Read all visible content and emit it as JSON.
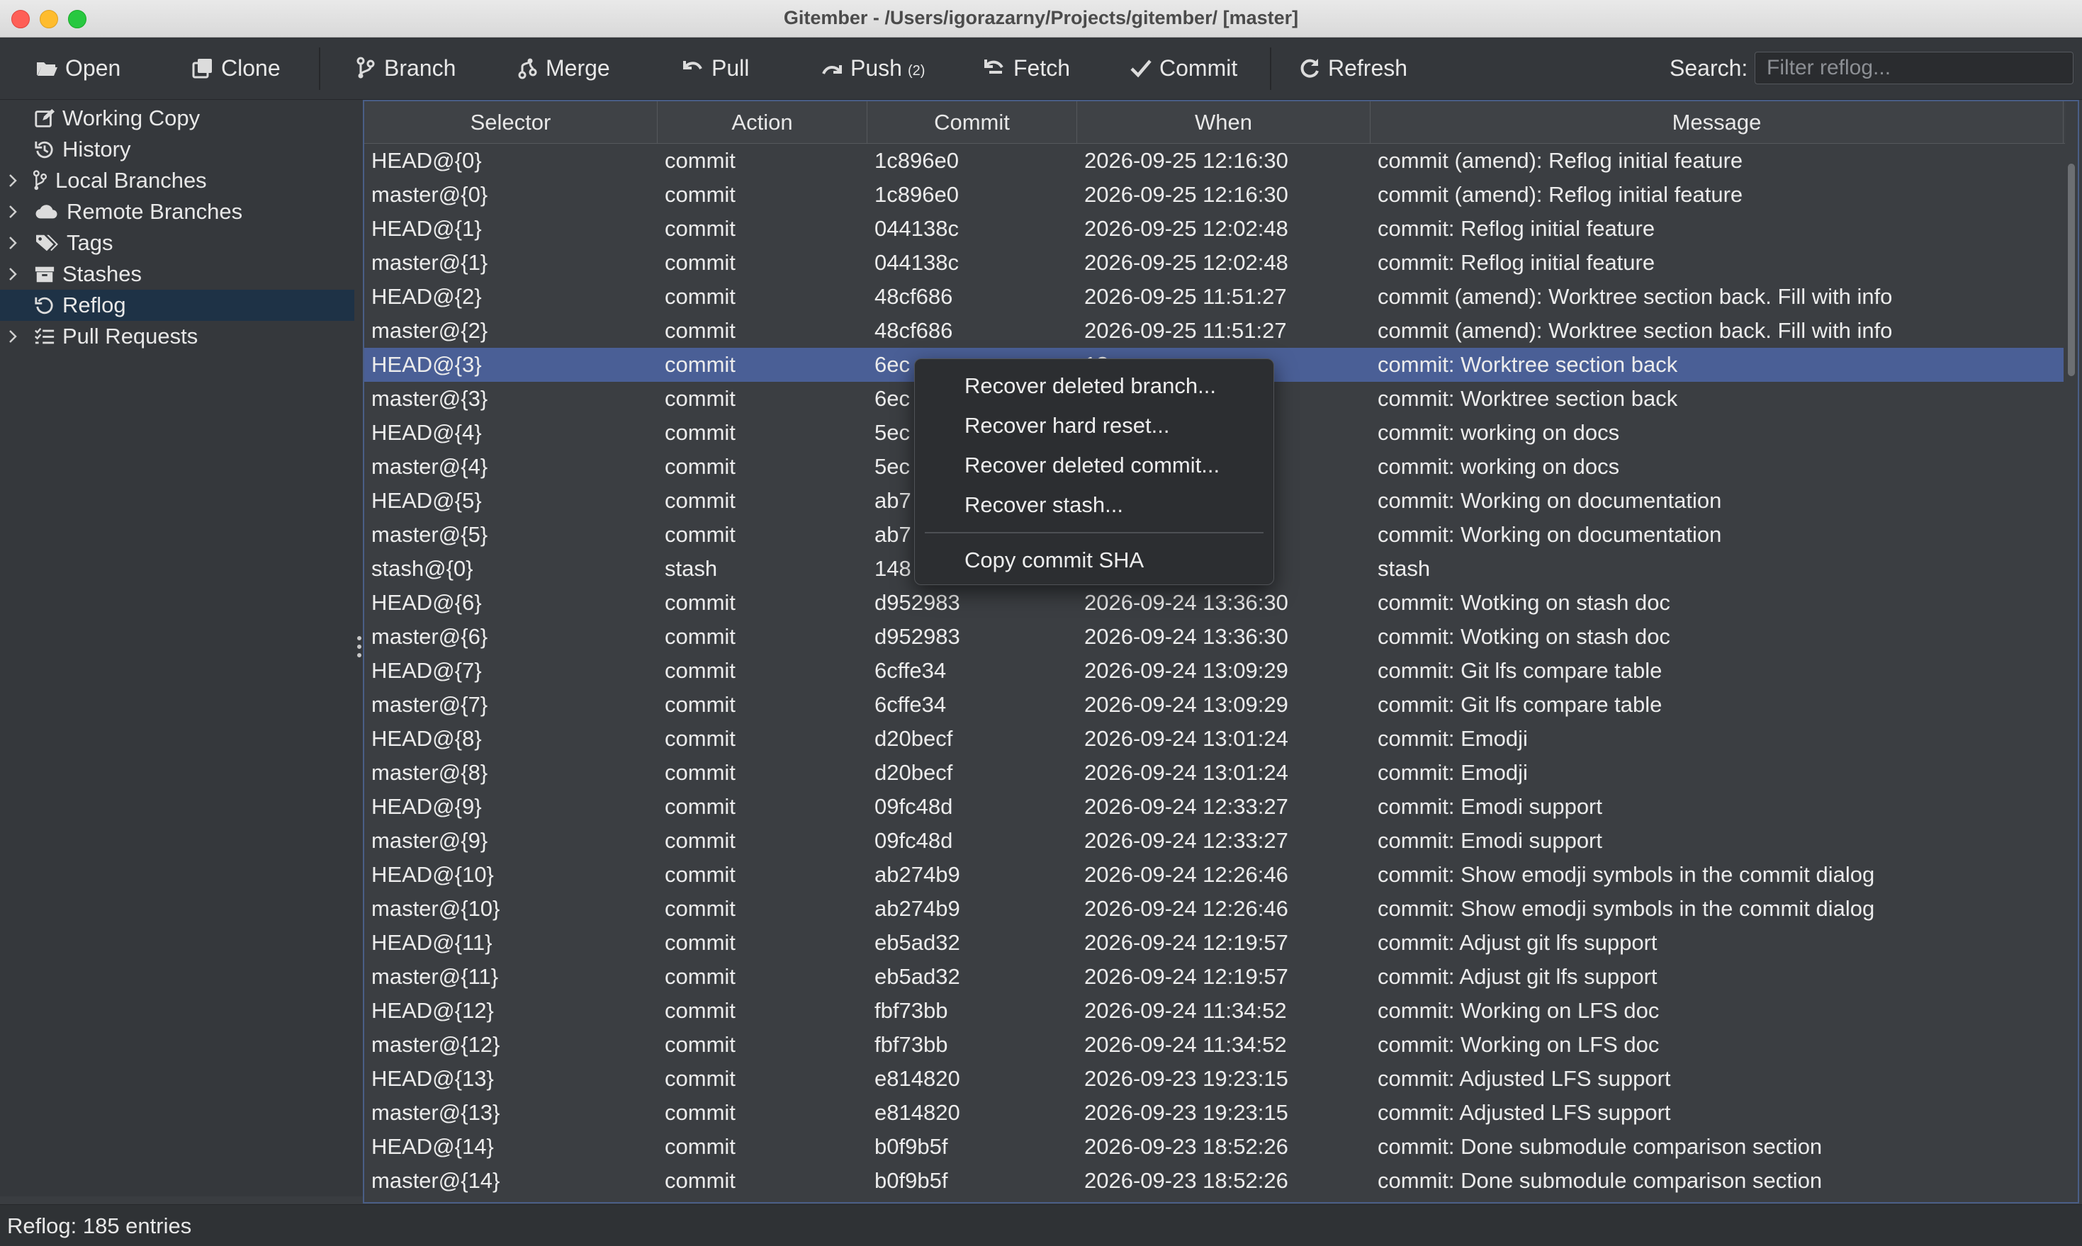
{
  "window": {
    "title": "Gitember - /Users/igorazarny/Projects/gitember/ [master]"
  },
  "toolbar": {
    "open": "Open",
    "clone": "Clone",
    "branch": "Branch",
    "merge": "Merge",
    "pull": "Pull",
    "push": "Push",
    "push_count": "(2)",
    "fetch": "Fetch",
    "commit": "Commit",
    "refresh": "Refresh",
    "search_label": "Search:",
    "search_placeholder": "Filter reflog...",
    "search_value": ""
  },
  "sidebar": {
    "items": [
      {
        "label": "Working Copy",
        "icon": "edit-icon",
        "expandable": false
      },
      {
        "label": "History",
        "icon": "history-icon",
        "expandable": false
      },
      {
        "label": "Local Branches",
        "icon": "branch-icon",
        "expandable": true
      },
      {
        "label": "Remote Branches",
        "icon": "cloud-icon",
        "expandable": true
      },
      {
        "label": "Tags",
        "icon": "tags-icon",
        "expandable": true
      },
      {
        "label": "Stashes",
        "icon": "archive-icon",
        "expandable": true
      },
      {
        "label": "Reflog",
        "icon": "history-icon",
        "expandable": false,
        "selected": true
      },
      {
        "label": "Pull Requests",
        "icon": "list-icon",
        "expandable": true
      }
    ]
  },
  "table": {
    "columns": [
      "Selector",
      "Action",
      "Commit",
      "When",
      "Message"
    ],
    "selected_row": 6,
    "rows": [
      [
        "HEAD@{0}",
        "commit",
        "1c896e0",
        "2026-09-25 12:16:30",
        "commit (amend): Reflog initial feature"
      ],
      [
        "master@{0}",
        "commit",
        "1c896e0",
        "2026-09-25 12:16:30",
        "commit (amend): Reflog initial feature"
      ],
      [
        "HEAD@{1}",
        "commit",
        "044138c",
        "2026-09-25 12:02:48",
        "commit: Reflog initial feature"
      ],
      [
        "master@{1}",
        "commit",
        "044138c",
        "2026-09-25 12:02:48",
        "commit: Reflog initial feature"
      ],
      [
        "HEAD@{2}",
        "commit",
        "48cf686",
        "2026-09-25 11:51:27",
        "commit (amend): Worktree section back. Fill with info"
      ],
      [
        "master@{2}",
        "commit",
        "48cf686",
        "2026-09-25 11:51:27",
        "commit (amend): Worktree section back. Fill with info"
      ],
      [
        "HEAD@{3}",
        "commit",
        "6ec",
        "13",
        "commit: Worktree section back"
      ],
      [
        "master@{3}",
        "commit",
        "6ec",
        "13",
        "commit: Worktree section back"
      ],
      [
        "HEAD@{4}",
        "commit",
        "5ec",
        "52",
        "commit: working on docs"
      ],
      [
        "master@{4}",
        "commit",
        "5ec",
        "52",
        "commit: working on docs"
      ],
      [
        "HEAD@{5}",
        "commit",
        "ab7",
        "18",
        "commit: Working on documentation"
      ],
      [
        "master@{5}",
        "commit",
        "ab7",
        "18",
        "commit: Working on documentation"
      ],
      [
        "stash@{0}",
        "stash",
        "148",
        "49",
        "stash"
      ],
      [
        "HEAD@{6}",
        "commit",
        "d952983",
        "2026-09-24 13:36:30",
        "commit: Wotking on stash doc"
      ],
      [
        "master@{6}",
        "commit",
        "d952983",
        "2026-09-24 13:36:30",
        "commit: Wotking on stash doc"
      ],
      [
        "HEAD@{7}",
        "commit",
        "6cffe34",
        "2026-09-24 13:09:29",
        "commit: Git lfs compare table"
      ],
      [
        "master@{7}",
        "commit",
        "6cffe34",
        "2026-09-24 13:09:29",
        "commit: Git lfs compare table"
      ],
      [
        "HEAD@{8}",
        "commit",
        "d20becf",
        "2026-09-24 13:01:24",
        "commit: Emodji"
      ],
      [
        "master@{8}",
        "commit",
        "d20becf",
        "2026-09-24 13:01:24",
        "commit: Emodji"
      ],
      [
        "HEAD@{9}",
        "commit",
        "09fc48d",
        "2026-09-24 12:33:27",
        "commit: Emodi support"
      ],
      [
        "master@{9}",
        "commit",
        "09fc48d",
        "2026-09-24 12:33:27",
        "commit: Emodi support"
      ],
      [
        "HEAD@{10}",
        "commit",
        "ab274b9",
        "2026-09-24 12:26:46",
        "commit: Show emodji symbols in the commit dialog"
      ],
      [
        "master@{10}",
        "commit",
        "ab274b9",
        "2026-09-24 12:26:46",
        "commit: Show emodji symbols in the commit dialog"
      ],
      [
        "HEAD@{11}",
        "commit",
        "eb5ad32",
        "2026-09-24 12:19:57",
        "commit: Adjust git lfs support"
      ],
      [
        "master@{11}",
        "commit",
        "eb5ad32",
        "2026-09-24 12:19:57",
        "commit: Adjust git lfs support"
      ],
      [
        "HEAD@{12}",
        "commit",
        "fbf73bb",
        "2026-09-24 11:34:52",
        "commit: Working on LFS doc"
      ],
      [
        "master@{12}",
        "commit",
        "fbf73bb",
        "2026-09-24 11:34:52",
        "commit: Working on LFS doc"
      ],
      [
        "HEAD@{13}",
        "commit",
        "e814820",
        "2026-09-23 19:23:15",
        "commit: Adjusted LFS support"
      ],
      [
        "master@{13}",
        "commit",
        "e814820",
        "2026-09-23 19:23:15",
        "commit: Adjusted LFS support"
      ],
      [
        "HEAD@{14}",
        "commit",
        "b0f9b5f",
        "2026-09-23 18:52:26",
        "commit: Done submodule comparison section"
      ],
      [
        "master@{14}",
        "commit",
        "b0f9b5f",
        "2026-09-23 18:52:26",
        "commit: Done submodule comparison section"
      ]
    ]
  },
  "context_menu": {
    "items": [
      "Recover deleted branch...",
      "Recover hard reset...",
      "Recover deleted commit...",
      "Recover stash..."
    ],
    "copy_sha": "Copy commit SHA"
  },
  "status": {
    "text": "Reflog: 185 entries"
  },
  "colors": {
    "selection": "#4a5f96",
    "sidebar_selection": "#1e3246",
    "background": "#3b3e42"
  }
}
